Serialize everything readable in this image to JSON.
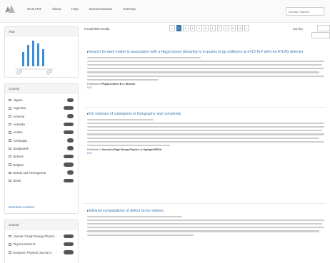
{
  "header": {
    "nav": [
      "SCOAP3",
      "About",
      "Help",
      "Documentation",
      "Sitemap"
    ],
    "search_value": "country:\"Greece\""
  },
  "colors": {
    "accent": "#3b78b4",
    "histogram": "#3b8fd9"
  },
  "sidebar": {
    "year_panel": {
      "title": "Year"
    },
    "country_panel": {
      "title": "Country",
      "items": [
        {
          "label": "Algeria"
        },
        {
          "label": "Argentina"
        },
        {
          "label": "Armenia"
        },
        {
          "label": "Australia"
        },
        {
          "label": "Austria"
        },
        {
          "label": "Azerbaijan"
        },
        {
          "label": "Bangladesh"
        },
        {
          "label": "Belarus"
        },
        {
          "label": "Belgium"
        },
        {
          "label": "Bosnia and Herzegovina"
        },
        {
          "label": "Brazil"
        }
      ],
      "more_label": "More/less countries"
    },
    "journal_panel": {
      "title": "Journal",
      "items": [
        {
          "label": "Journal of High Energy Physics"
        },
        {
          "label": "Physics letters B"
        },
        {
          "label": "European Physical Journal C"
        }
      ]
    }
  },
  "main": {
    "found_text": "Found 936 results.",
    "pagination": [
      "«",
      "1",
      "2",
      "3",
      "4",
      "5",
      "6",
      "7",
      "8",
      "9",
      "10",
      "»"
    ],
    "sort_label": "Sort by:",
    "results": [
      {
        "title": "Search for dark matter in association with a Higgs boson decaying to b-quarks in pp collisions at s=13 TeV with the ATLAS detector",
        "published_prefix": "Published in",
        "journal": "Physics letters B",
        "publisher_prefix": "by",
        "publisher": "Elsevier",
        "doi_prefix": "DOI:"
      },
      {
        "title": "On volumes of subregions in holography and complexity",
        "published_prefix": "Published in",
        "journal": "Journal of High Energy Physics",
        "publisher_prefix": "by",
        "publisher": "Springer/SISSA",
        "doi_prefix": "DOI:"
      },
      {
        "title": "Infrared computations of defect Schur indices"
      }
    ]
  }
}
